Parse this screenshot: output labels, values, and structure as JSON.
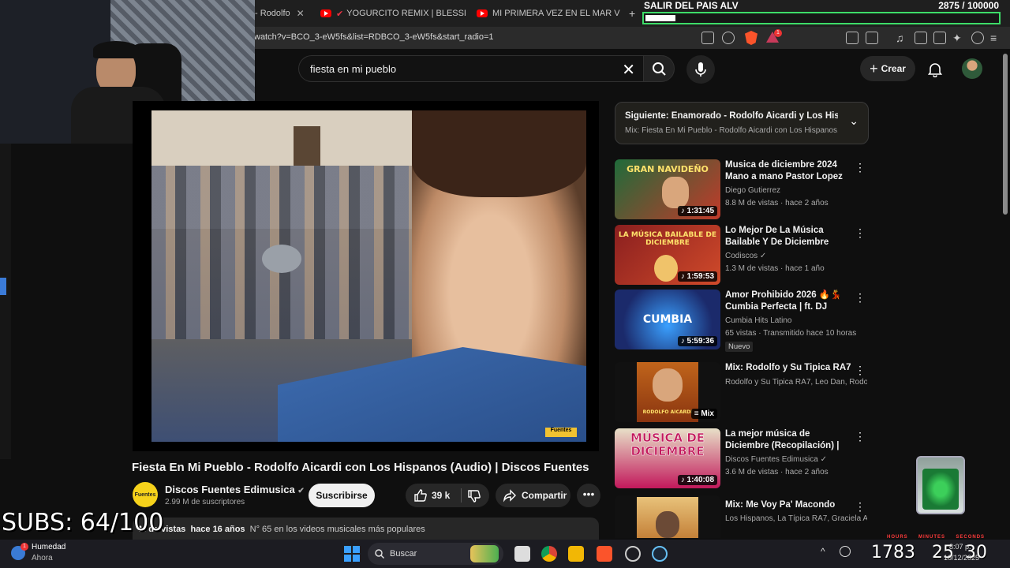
{
  "browser": {
    "tabs": [
      {
        "label": "- Rodolfo"
      },
      {
        "label": "YOGURCITO REMIX | BLESSD"
      },
      {
        "label": "MI PRIMERA VEZ EN EL MAR VLOG"
      }
    ],
    "new_tab": "+",
    "url": "watch?v=BCO_3-eW5fs&list=RDBCO_3-eW5fs&start_radio=1",
    "extension_badge": "1"
  },
  "overlay": {
    "goal_label": "SALIR DEL PAIS ALV",
    "goal_count": "2875 / 100000",
    "goal_progress": 0.02875,
    "subs_counter": "SUBS: 64/100",
    "timer": {
      "hours": "1783",
      "minutes": "25",
      "seconds": "30",
      "label_hours": "HOURS",
      "label_minutes": "MINUTES",
      "label_seconds": "SECONDS"
    }
  },
  "header": {
    "search_value": "fiesta en mi pueblo",
    "create_label": "Crear"
  },
  "video": {
    "title": "Fiesta En Mi Pueblo - Rodolfo Aicardi con Los Hispanos (Audio) | Discos Fuentes",
    "channel": "Discos Fuentes Edimusica",
    "channel_logo_text": "Fuentes",
    "subscribers": "2.99 M de suscriptores",
    "subscribe_label": "Suscribirse",
    "likes": "39 k",
    "share_label": "Compartir",
    "views": "M de vistas",
    "age": "hace 16 años",
    "rank": "N° 65 en los videos musicales más populares",
    "watermark": "Fuentes"
  },
  "upnext": {
    "title": "Siguiente: Enamorado - Rodolfo Aicardi y Los Hispa...",
    "subtitle": "Mix: Fiesta En Mi Pueblo - Rodolfo Aicardi con Los Hispanos..."
  },
  "recommendations": [
    {
      "title": "Musica de diciembre 2024 Mano a mano Pastor Lopez & ...",
      "channel": "Diego Gutierrez",
      "meta": "8.8 M de vistas · hace 2 años",
      "duration": "1:31:45",
      "thumb_text": "GRAN NAVIDEÑO",
      "thumb_color": "#1f6b3a"
    },
    {
      "title": "Lo Mejor De La Música Bailable Y De Diciembre",
      "channel": "Codiscos ✓",
      "meta": "1.3 M de vistas · hace 1 año",
      "duration": "1:59:53",
      "thumb_text": "LA MÚSICA BAILABLE DE DICIEMBRE",
      "thumb_color": "#8a1f1f"
    },
    {
      "title": "Amor Prohibido 2026 🔥💃 Cumbia Perfecta | ft. DJ Marti...",
      "channel": "Cumbia Hits Latino",
      "meta": "65 vistas · Transmitido hace 10 horas",
      "badge": "Nuevo",
      "duration": "5:59:36",
      "thumb_text": "CUMBIA",
      "thumb_color": "#1b2a6b"
    },
    {
      "title": "Mix: Rodolfo y Su Tipica RA7",
      "channel": "Rodolfo y Su Tipica RA7, Leo Dan, Rodolfo Aicardi",
      "meta": "",
      "duration": "Mix",
      "thumb_text": "RODOLFO AICARDI",
      "thumb_color": "#c0641b"
    },
    {
      "title": "La mejor música de Diciembre (Recopilación) | Discos Fuentes",
      "channel": "Discos Fuentes Edimusica ✓",
      "meta": "3.6 M de vistas · hace 2 años",
      "duration": "1:40:08",
      "thumb_text": "MÚSICA DE DICIEMBRE",
      "thumb_color": "#c2185b"
    },
    {
      "title": "Mix: Me Voy Pa' Macondo",
      "channel": "Los Hispanos, La Típica RA7, Graciela Ar...",
      "meta": "",
      "duration": "",
      "thumb_text": "",
      "thumb_color": "#b5651d"
    }
  ],
  "taskbar": {
    "weather_title": "Humedad",
    "weather_sub": "Ahora",
    "search_placeholder": "Buscar",
    "clock_time": "8:07 p.",
    "clock_date": "10/12/2025"
  },
  "colors": {
    "accent_green": "#3ddc68",
    "youtube_red": "#ff0000"
  }
}
